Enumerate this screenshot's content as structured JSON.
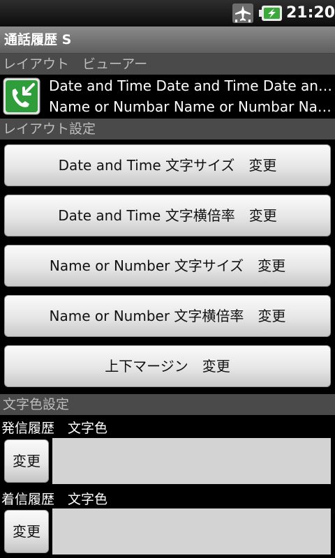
{
  "status_bar": {
    "time": "21:20",
    "icons": [
      "airplane-mode-icon",
      "battery-charging-icon"
    ]
  },
  "title_bar": {
    "title": "通話履歴 S"
  },
  "sections": {
    "layout_viewer": "レイアウト　ビューアー",
    "layout_settings": "レイアウト設定",
    "text_color_settings": "文字色設定"
  },
  "preview": {
    "icon": "outgoing-call-icon",
    "line1": "Date and Time Date and Time Date and Time",
    "line2": "Name or Numbar Name or Numbar Name or Numbar"
  },
  "layout_buttons": [
    "Date and Time 文字サイズ　変更",
    "Date and Time 文字横倍率　変更",
    "Name or Number 文字サイズ　変更",
    "Name or Number 文字横倍率　変更",
    "上下マージン　変更"
  ],
  "color_settings": [
    {
      "label": "発信履歴　文字色",
      "button": "変更",
      "color": "#d3d3d3"
    },
    {
      "label": "着信履歴　文字色",
      "button": "変更",
      "color": "#d3d3d3"
    }
  ],
  "colors": {
    "background": "#000000",
    "section_header": "#4a4a4a",
    "title_bar": "#777777",
    "call_icon_green": "#2f9e3a"
  }
}
